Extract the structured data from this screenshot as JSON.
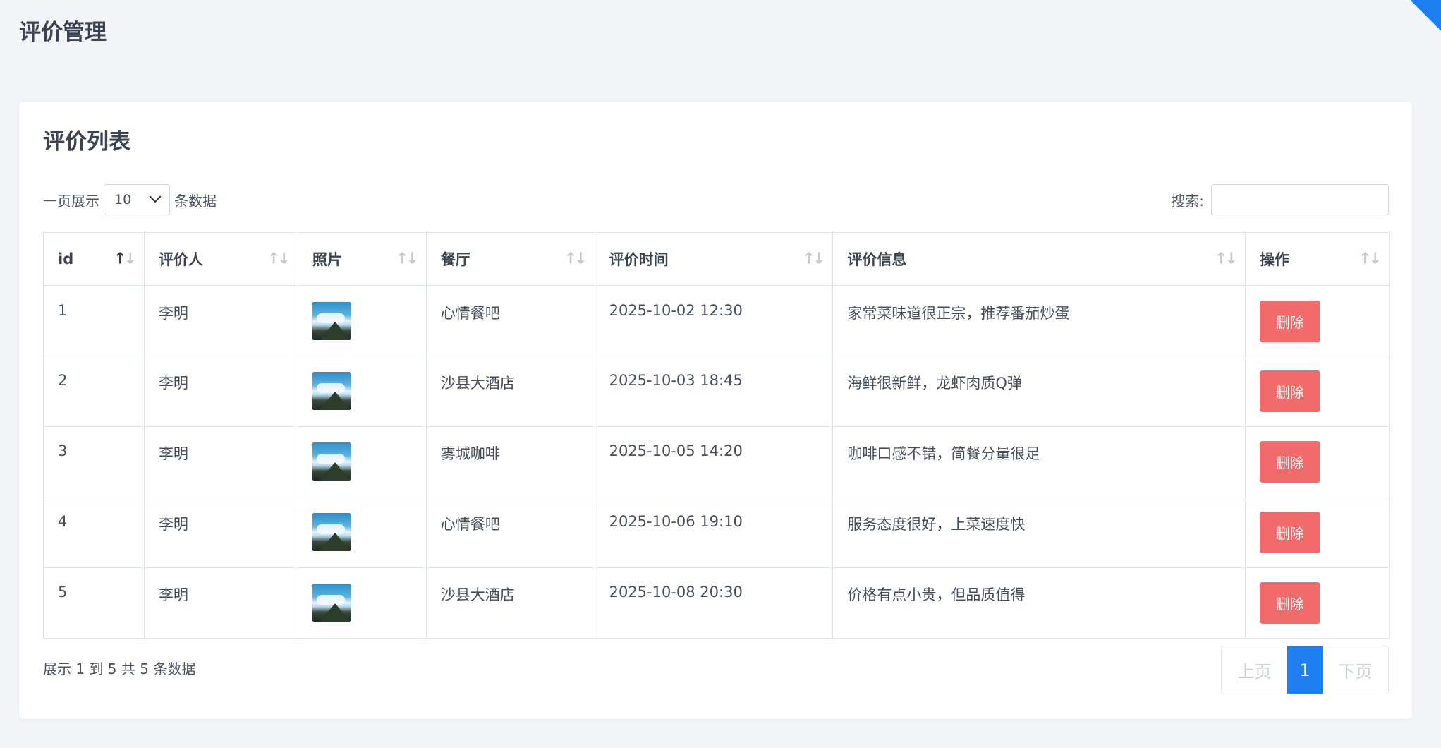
{
  "page": {
    "title": "评价管理"
  },
  "card": {
    "title": "评价列表",
    "length": {
      "prefix": "一页展示",
      "value": "10",
      "suffix": "条数据"
    },
    "search": {
      "label": "搜索:",
      "value": ""
    }
  },
  "table": {
    "columns": [
      "id",
      "评价人",
      "照片",
      "餐厅",
      "评价时间",
      "评价信息",
      "操作"
    ],
    "sort_glyph": "↑↓",
    "rows": [
      {
        "id": "1",
        "reviewer": "李明",
        "photo": "mountain-photo",
        "restaurant": "心情餐吧",
        "time": "2025-10-02 12:30",
        "message": "家常菜味道很正宗，推荐番茄炒蛋",
        "action": "删除"
      },
      {
        "id": "2",
        "reviewer": "李明",
        "photo": "mountain-photo",
        "restaurant": "沙县大酒店",
        "time": "2025-10-03 18:45",
        "message": "海鲜很新鲜，龙虾肉质Q弹",
        "action": "删除"
      },
      {
        "id": "3",
        "reviewer": "李明",
        "photo": "mountain-photo",
        "restaurant": "雾城咖啡",
        "time": "2025-10-05 14:20",
        "message": "咖啡口感不错，简餐分量很足",
        "action": "删除"
      },
      {
        "id": "4",
        "reviewer": "李明",
        "photo": "mountain-photo",
        "restaurant": "心情餐吧",
        "time": "2025-10-06 19:10",
        "message": "服务态度很好，上菜速度快",
        "action": "删除"
      },
      {
        "id": "5",
        "reviewer": "李明",
        "photo": "mountain-photo",
        "restaurant": "沙县大酒店",
        "time": "2025-10-08 20:30",
        "message": "价格有点小贵，但品质值得",
        "action": "删除"
      }
    ]
  },
  "footer": {
    "info": "展示 1 到 5 共 5 条数据",
    "pager": {
      "prev": "上页",
      "current": "1",
      "next": "下页"
    }
  },
  "colors": {
    "accent": "#1e7ff0",
    "danger": "#f16b6b"
  }
}
